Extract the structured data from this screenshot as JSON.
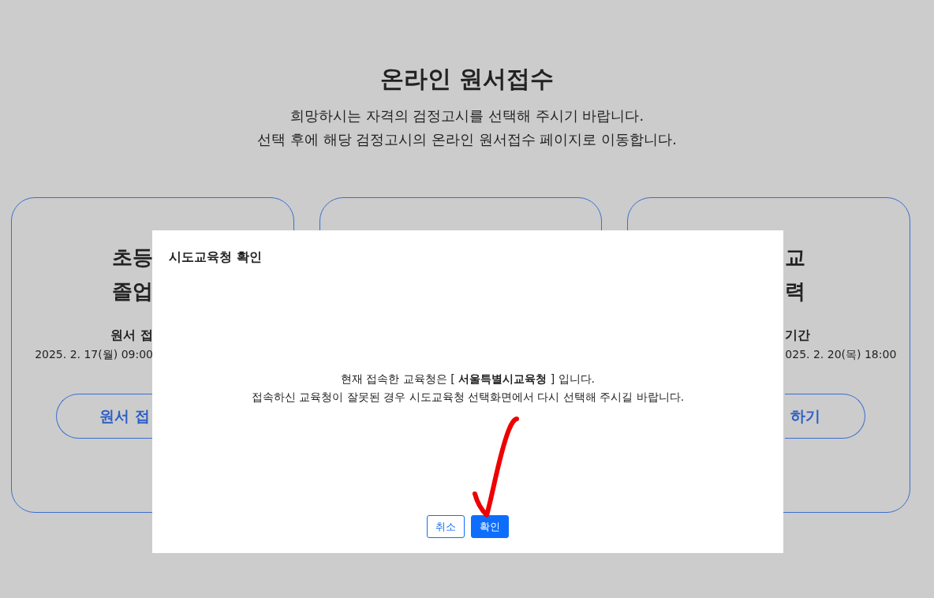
{
  "header": {
    "title": "온라인 원서접수",
    "subtitle_lines": [
      "희망하시는 자격의 검정고시를 선택해 주시기 바랍니다.",
      "선택 후에 해당 검정고시의 온라인 원서접수 페이지로 이동합니다."
    ]
  },
  "cards": [
    {
      "kind": "cut-right",
      "title_lines": [
        "초등",
        "졸업"
      ],
      "period_label": "원서 접",
      "period": "2025. 2. 17(월) 09:00",
      "button": "원서 접"
    },
    {
      "kind": "covered"
    },
    {
      "kind": "cut-left",
      "title_lines": [
        "교",
        "력"
      ],
      "period_label": "기간",
      "period": "025. 2. 20(목) 18:00",
      "button": "하기"
    }
  ],
  "modal": {
    "title": "시도교육청 확인",
    "message_lines": [
      "현재 접속한 교육청은 [ **서울특별시교육청** ] 입니다.",
      "접속하신 교육청이 잘못된 경우 시도교육청 선택화면에서 다시 선택해 주시길 바랍니다."
    ],
    "buttons": [
      {
        "label": "취소",
        "kind": "outline"
      },
      {
        "label": "확인",
        "kind": "primary"
      }
    ]
  }
}
